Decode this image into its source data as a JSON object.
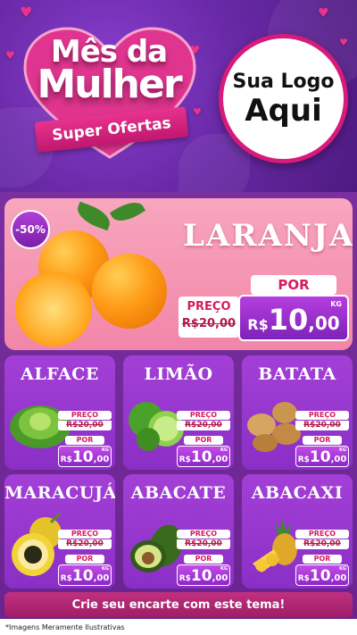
{
  "header": {
    "title_line1": "Mês da",
    "title_line2": "Mulher",
    "ribbon": "Super Ofertas",
    "logo_line1": "Sua Logo",
    "logo_line2": "Aqui"
  },
  "featured": {
    "discount": "-50%",
    "name": "LARANJA",
    "preco_label": "PREÇO",
    "old_price": "R$20,00",
    "por_label": "POR",
    "currency": "R$",
    "price_int": "10",
    "price_dec": ",00",
    "unit": "KG"
  },
  "products": [
    {
      "name": "ALFACE",
      "preco_label": "PREÇO",
      "old_price": "R$20,00",
      "por_label": "POR",
      "currency": "R$",
      "price_int": "10",
      "price_dec": ",00",
      "unit": "KG"
    },
    {
      "name": "LIMÃO",
      "preco_label": "PREÇO",
      "old_price": "R$20,00",
      "por_label": "POR",
      "currency": "R$",
      "price_int": "10",
      "price_dec": ",00",
      "unit": "KG"
    },
    {
      "name": "BATATA",
      "preco_label": "PREÇO",
      "old_price": "R$20,00",
      "por_label": "POR",
      "currency": "R$",
      "price_int": "10",
      "price_dec": ",00",
      "unit": "KG"
    },
    {
      "name": "MARACUJÁ",
      "preco_label": "PREÇO",
      "old_price": "R$20,00",
      "por_label": "POR",
      "currency": "R$",
      "price_int": "10",
      "price_dec": ",00",
      "unit": "KG"
    },
    {
      "name": "ABACATE",
      "preco_label": "PREÇO",
      "old_price": "R$20,00",
      "por_label": "POR",
      "currency": "R$",
      "price_int": "10",
      "price_dec": ",00",
      "unit": "KG"
    },
    {
      "name": "ABACAXI",
      "preco_label": "PREÇO",
      "old_price": "R$20,00",
      "por_label": "POR",
      "currency": "R$",
      "price_int": "10",
      "price_dec": ",00",
      "unit": "KG"
    }
  ],
  "cta": "Crie seu encarte com este tema!",
  "footer": "*Imagens Meramente Ilustrativas",
  "colors": {
    "purple": "#7a2fa0",
    "pink": "#d81b7a",
    "card": "#a33fd6",
    "feature_bg": "#f8a6be"
  }
}
